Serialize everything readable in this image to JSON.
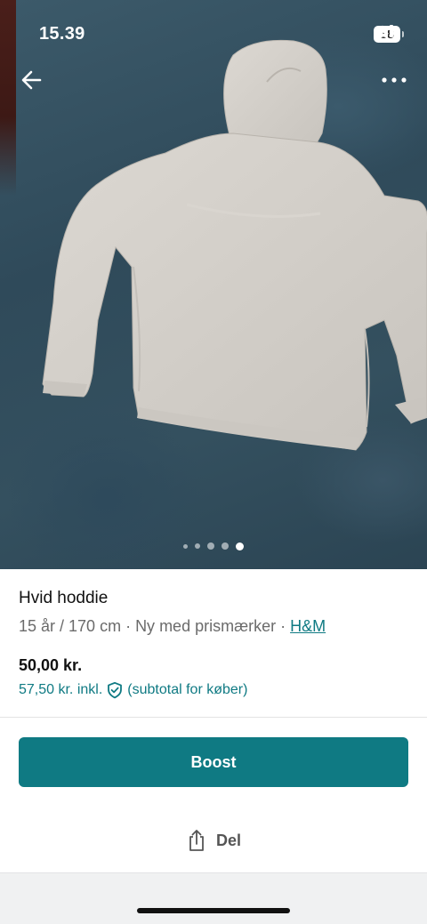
{
  "status_bar": {
    "time": "15.39",
    "battery": "88",
    "icons": [
      "cellular-signal-icon",
      "wifi-icon",
      "battery-icon"
    ]
  },
  "navigation": {
    "back_icon": "arrow-left-icon",
    "more_icon": "more-horizontal-icon"
  },
  "gallery": {
    "image_count": 5,
    "active_index": 4,
    "image_subject": "hoodie-photo"
  },
  "item": {
    "title": "Hvid hoddie",
    "size": "15 år / 170 cm",
    "separator": " · ",
    "condition": "Ny med prismærker",
    "brand": "H&M",
    "price": "50,00 kr.",
    "price_incl": "57,50 kr. inkl.",
    "price_incl_note": "(subtotal for køber)",
    "protection_icon": "shield-check-icon"
  },
  "actions": {
    "boost_label": "Boost",
    "share_label": "Del",
    "share_icon": "share-icon"
  },
  "colors": {
    "accent": "#0f7a83",
    "text_primary": "#111111",
    "text_secondary": "#6b6b6b",
    "bottom_bar": "#f0f1f2"
  }
}
